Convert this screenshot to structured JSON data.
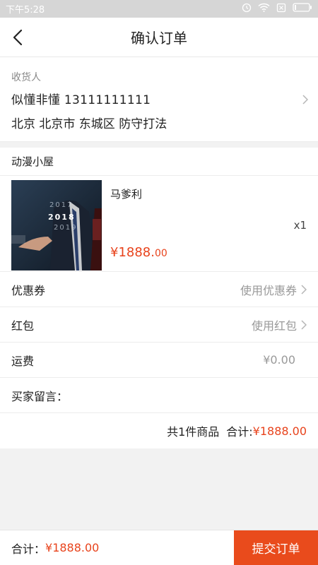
{
  "status": {
    "time": "下午5:28"
  },
  "nav": {
    "title": "确认订单"
  },
  "address": {
    "label": "收货人",
    "name_phone": "似懂非懂 13111111111",
    "area": "北京 北京市 东城区 防守打法"
  },
  "shop": {
    "name": "动漫小屋"
  },
  "product": {
    "name": "马爹利",
    "qty": "x1",
    "price_main": "¥1888.",
    "price_dec": "00",
    "image_text": [
      "2017",
      "2018",
      "2019"
    ]
  },
  "rows": {
    "coupon": {
      "label": "优惠券",
      "value": "使用优惠券"
    },
    "redpack": {
      "label": "红包",
      "value": "使用红包"
    },
    "shipping": {
      "label": "运费",
      "value": "¥0.00"
    },
    "message": {
      "label": "买家留言："
    }
  },
  "summary": {
    "count_text": "共1件商品",
    "total_label": "合计:",
    "total_value": "¥1888.00"
  },
  "footer": {
    "total_label": "合计：",
    "total_value": "¥1888.00",
    "submit_label": "提交订单"
  },
  "colors": {
    "accent": "#e8431c",
    "submit_bg": "#e94b1c"
  }
}
